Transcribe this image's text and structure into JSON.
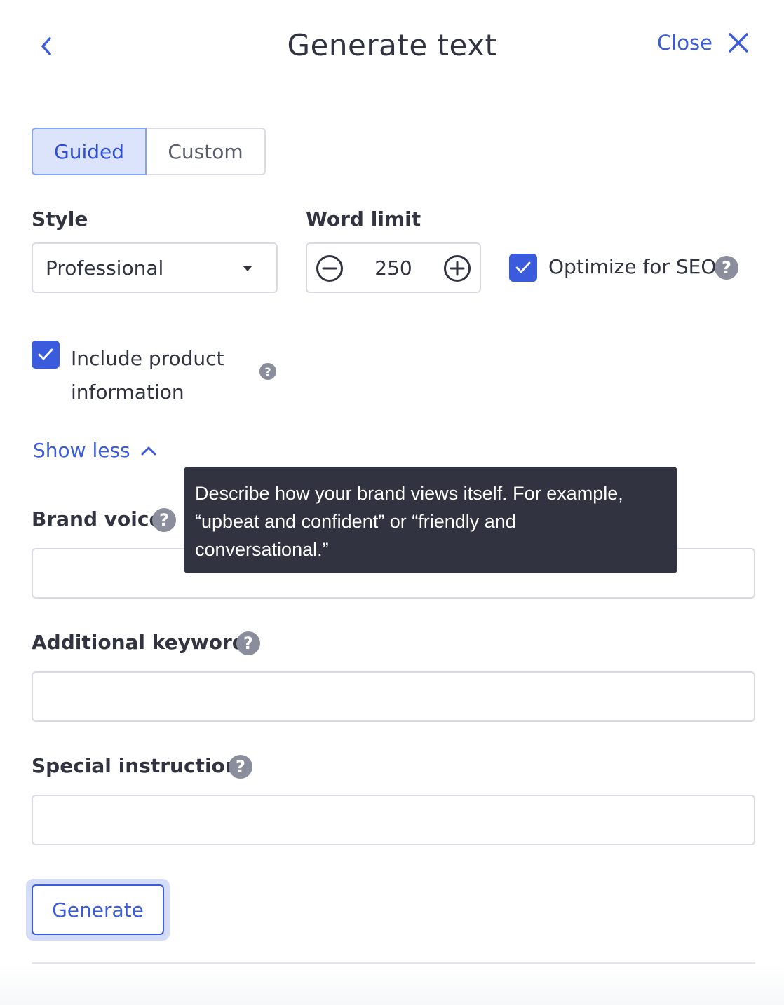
{
  "header": {
    "title": "Generate text",
    "back_icon": "chevron-left-icon",
    "close_label": "Close",
    "close_icon": "close-icon"
  },
  "mode_tabs": [
    {
      "label": "Guided",
      "active": true
    },
    {
      "label": "Custom",
      "active": false
    }
  ],
  "style": {
    "label": "Style",
    "value": "Professional",
    "icon": "caret-down-icon"
  },
  "word_limit": {
    "label": "Word limit",
    "value": "250",
    "decrement_icon": "minus-circle-icon",
    "increment_icon": "plus-circle-icon"
  },
  "optimize_seo": {
    "label": "Optimize for SEO",
    "checked": true
  },
  "include_product_info": {
    "label_line1": "Include product",
    "label_line2": "information",
    "checked": true
  },
  "show_less": {
    "label": "Show less",
    "icon": "chevron-up-icon"
  },
  "brand_voice": {
    "label": "Brand voice",
    "value": "",
    "tooltip_line1": "Describe how your brand views itself. For example,",
    "tooltip_line2": "“upbeat and confident” or “friendly and",
    "tooltip_line3": "conversational.”"
  },
  "additional_keywords": {
    "label": "Additional keywords",
    "value": ""
  },
  "special_instructions": {
    "label": "Special instructions",
    "value": ""
  },
  "help_icon_glyph": "?",
  "generate_button": {
    "label": "Generate"
  },
  "colors": {
    "accent": "#3a5bdc",
    "text": "#313440",
    "tooltip_bg": "#313440",
    "help_icon": "#8a8e9c",
    "tab_active_bg": "#dbe4fb"
  }
}
